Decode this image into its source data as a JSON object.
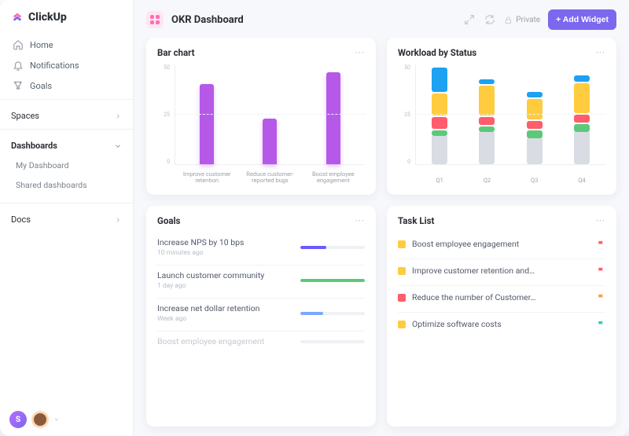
{
  "brand": {
    "name": "ClickUp"
  },
  "sidebar": {
    "nav": [
      {
        "label": "Home"
      },
      {
        "label": "Notifications"
      },
      {
        "label": "Goals"
      }
    ],
    "spaces_label": "Spaces",
    "dashboards_label": "Dashboards",
    "dashboards_items": [
      {
        "label": "My Dashboard"
      },
      {
        "label": "Shared dashboards"
      }
    ],
    "docs_label": "Docs",
    "avatar_initial": "S"
  },
  "header": {
    "title": "OKR Dashboard",
    "privacy": "Private",
    "add_widget": "+ Add Widget"
  },
  "cards": {
    "bar": {
      "title": "Bar chart"
    },
    "workload": {
      "title": "Workload by Status"
    },
    "goals": {
      "title": "Goals"
    },
    "tasks": {
      "title": "Task List"
    }
  },
  "chart_data": [
    {
      "id": "bar_chart",
      "type": "bar",
      "title": "Bar chart",
      "ylim": [
        0,
        50
      ],
      "yticks": [
        50,
        25,
        0
      ],
      "categories": [
        "Improve customer retention",
        "Reduce customer-reported bugs",
        "Boost employee engagement"
      ],
      "values": [
        40,
        23,
        46
      ]
    },
    {
      "id": "workload",
      "type": "stacked_bar",
      "title": "Workload by Status",
      "ylim": [
        0,
        50
      ],
      "yticks": [
        50,
        25,
        0
      ],
      "categories": [
        "Q1",
        "Q2",
        "Q3",
        "Q4"
      ],
      "stack_order": [
        "gray",
        "green",
        "red",
        "yellow",
        "blue"
      ],
      "series": [
        {
          "name": "gray",
          "color": "#d9dde3",
          "values": [
            14,
            16,
            13,
            16
          ]
        },
        {
          "name": "green",
          "color": "#5cc97a",
          "values": [
            3,
            3,
            4,
            4
          ]
        },
        {
          "name": "red",
          "color": "#ff5c6c",
          "values": [
            6,
            4,
            4,
            4
          ]
        },
        {
          "name": "yellow",
          "color": "#ffcc3f",
          "values": [
            11,
            15,
            10,
            15
          ]
        },
        {
          "name": "blue",
          "color": "#1da1f2",
          "values": [
            12,
            2,
            3,
            3
          ]
        }
      ]
    }
  ],
  "goals": [
    {
      "title": "Increase NPS by 10 bps",
      "sub": "10 minutes ago",
      "pct": 40,
      "color": "p-blue"
    },
    {
      "title": "Launch customer community",
      "sub": "1 day ago",
      "pct": 100,
      "color": "p-green"
    },
    {
      "title": "Increase net dollar retention",
      "sub": "Week ago",
      "pct": 35,
      "color": "p-lblue"
    },
    {
      "title": "Boost employee engagement",
      "sub": "",
      "pct": 0,
      "color": "p-blue",
      "faded": true
    }
  ],
  "tasks": [
    {
      "label": "Boost employee engagement",
      "sq": "y",
      "flag": "fl-r"
    },
    {
      "label": "Improve customer retention and…",
      "sq": "y",
      "flag": "fl-r"
    },
    {
      "label": "Reduce the number of Customer…",
      "sq": "r",
      "flag": "fl-o"
    },
    {
      "label": "Optimize software costs",
      "sq": "y",
      "flag": "fl-t"
    }
  ]
}
